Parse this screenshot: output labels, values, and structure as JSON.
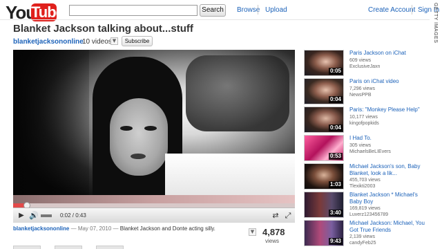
{
  "header": {
    "logo": {
      "you": "You",
      "tube": "Tube"
    },
    "search": {
      "value": "",
      "button_label": "Search"
    },
    "nav": {
      "browse": "Browse",
      "upload": "Upload",
      "create_account": "Create Account",
      "sign_in": "Sign In"
    },
    "watermark": "GETTY IMAGES"
  },
  "video": {
    "title": "Blanket Jackson talking about...stuff",
    "channel": "blanketjacksononline",
    "video_count": "10 videos",
    "subscribe_label": "Subscribe",
    "time": "0:02 / 0:43",
    "progress_fraction": 0.05,
    "info": {
      "user": "blanketjacksononline",
      "date": "— May 07, 2010 —",
      "description": "Blanket Jackson and Donte acting silly."
    },
    "views_count": "4,878",
    "views_label": "views"
  },
  "related": [
    {
      "title": "Paris Jackson on iChat",
      "views": "609 views",
      "author": "ExclusiveJaxn",
      "duration": "0:05",
      "thumb": "t-ichat"
    },
    {
      "title": "Paris on iChat video",
      "views": "7,296 views",
      "author": "NewsPPB",
      "duration": "0:04",
      "thumb": "t-ichat2"
    },
    {
      "title": "Paris: \"Monkey Please Help\"",
      "views": "10,177 views",
      "author": "kingofpopkids",
      "duration": "0:04",
      "thumb": "t-monkey"
    },
    {
      "title": "I Had To.",
      "views": "305 views",
      "author": "MichaelsBeLIEvers",
      "duration": "0:53",
      "thumb": "t-ihad"
    },
    {
      "title": "Michael Jackson's son, Baby Blanket, look a lik...",
      "views": "455,703 views",
      "author": "Tlexikti2003",
      "duration": "1:03",
      "thumb": "t-baby"
    },
    {
      "title": "Blanket Jackson * Michael's Baby Boy",
      "views": "169,819 views",
      "author": "Luverz123456789",
      "duration": "3:40",
      "thumb": "t-baby2"
    },
    {
      "title": "Michael Jackson: Michael, You Got True Friends",
      "views": "2,139 views",
      "author": "candyFeb25",
      "duration": "9:43",
      "thumb": "t-friends"
    }
  ]
}
